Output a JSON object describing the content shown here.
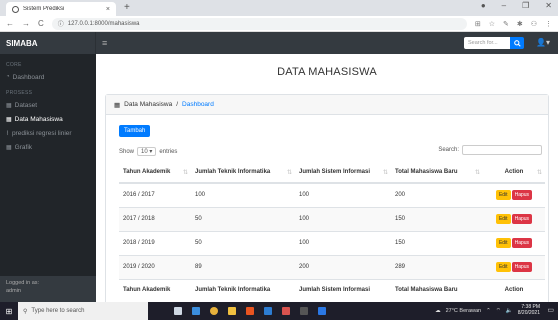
{
  "browser": {
    "tab_title": "Sistem Prediksi",
    "tab_close": "×",
    "new_tab": "+",
    "url": "127.0.0.1:8000/mahasiswa",
    "back": "←",
    "forward": "→",
    "reload": "C",
    "info": "ⓘ"
  },
  "navbar": {
    "brand": "SIMABA",
    "menu_icon": "≡",
    "search_placeholder": "Search for...",
    "search_button_icon": "search-icon",
    "user_icon": "user-icon"
  },
  "sidebar": {
    "sections": [
      {
        "heading": "CORE",
        "items": [
          {
            "label": "Dashboard",
            "icon": "dashboard-icon",
            "active": false
          }
        ]
      },
      {
        "heading": "PROSESS",
        "items": [
          {
            "label": "Dataset",
            "icon": "table-icon",
            "active": false
          },
          {
            "label": "Data Mahasiswa",
            "icon": "table-icon",
            "active": true
          },
          {
            "label": "prediksi regresi linier",
            "icon": "chart-icon",
            "active": false
          },
          {
            "label": "Grafik",
            "icon": "table-icon",
            "active": false
          }
        ]
      }
    ],
    "footer_line1": "Logged in as:",
    "footer_line2": "admin"
  },
  "main": {
    "title": "DATA MAHASISWA",
    "breadcrumb_current": "Data Mahasiswa",
    "breadcrumb_sep": "/",
    "breadcrumb_link": "Dashboard",
    "add_button": "Tambah",
    "show_label": "Show",
    "show_value": "10",
    "entries_label": "entries",
    "search_label": "Search:",
    "table": {
      "columns": [
        "Tahun Akademik",
        "Jumlah Teknik Informatika",
        "Jumlah Sistem Informasi",
        "Total Mahasiswa Baru",
        "Action"
      ],
      "rows": [
        [
          "2016 / 2017",
          "100",
          "100",
          "200"
        ],
        [
          "2017 / 2018",
          "50",
          "100",
          "150"
        ],
        [
          "2018 / 2019",
          "50",
          "100",
          "150"
        ],
        [
          "2019 / 2020",
          "89",
          "200",
          "289"
        ]
      ],
      "edit_label": "Edit",
      "delete_label": "Hapus"
    }
  },
  "taskbar": {
    "search_placeholder": "Type here to search",
    "weather": "27°C Berawan",
    "time": "7:38 PM",
    "date": "8/20/2021"
  }
}
